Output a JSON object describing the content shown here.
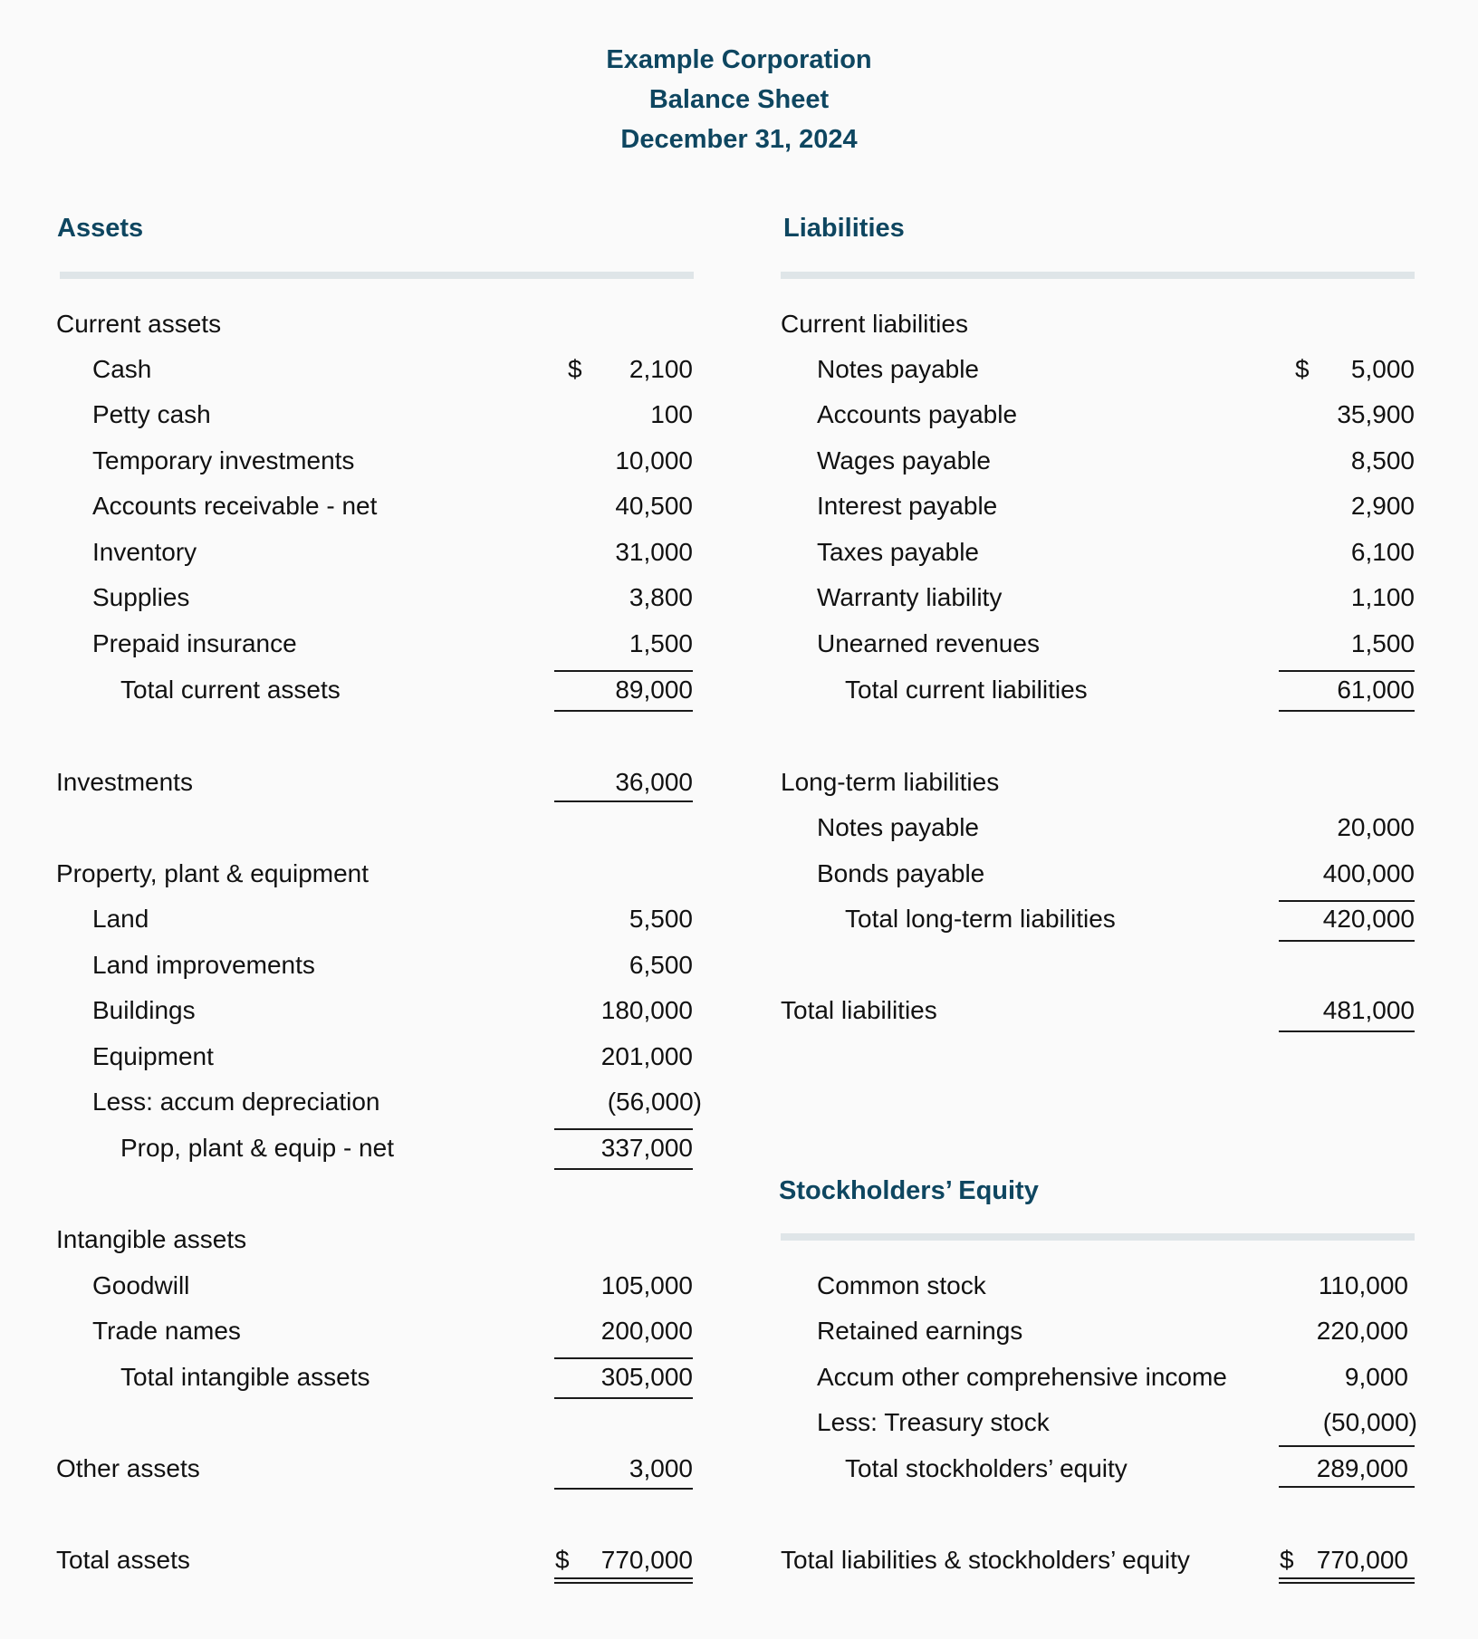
{
  "header": {
    "company": "Example Corporation",
    "statement": "Balance Sheet",
    "date": "December 31, 2024"
  },
  "assets": {
    "heading": "Assets",
    "current": {
      "label": "Current assets",
      "items": [
        {
          "label": "Cash",
          "currency": "$",
          "value": "2,100"
        },
        {
          "label": "Petty cash",
          "value": "100"
        },
        {
          "label": "Temporary investments",
          "value": "10,000"
        },
        {
          "label": "Accounts receivable - net",
          "value": "40,500"
        },
        {
          "label": "Inventory",
          "value": "31,000"
        },
        {
          "label": "Supplies",
          "value": "3,800"
        },
        {
          "label": "Prepaid insurance",
          "value": "1,500"
        }
      ],
      "total_label": "Total current assets",
      "total_value": "89,000"
    },
    "investments": {
      "label": "Investments",
      "value": "36,000"
    },
    "ppe": {
      "label": "Property, plant & equipment",
      "items": [
        {
          "label": "Land",
          "value": "5,500"
        },
        {
          "label": "Land improvements",
          "value": "6,500"
        },
        {
          "label": "Buildings",
          "value": "180,000"
        },
        {
          "label": "Equipment",
          "value": "201,000"
        },
        {
          "label": "Less: accum depreciation",
          "value": "(56,000)"
        }
      ],
      "total_label": "Prop, plant & equip - net",
      "total_value": "337,000"
    },
    "intangible": {
      "label": "Intangible assets",
      "items": [
        {
          "label": "Goodwill",
          "value": "105,000"
        },
        {
          "label": "Trade names",
          "value": "200,000"
        }
      ],
      "total_label": "Total intangible assets",
      "total_value": "305,000"
    },
    "other": {
      "label": "Other assets",
      "value": "3,000"
    },
    "total": {
      "label": "Total assets",
      "currency": "$",
      "value": "770,000"
    }
  },
  "liabilities": {
    "heading": "Liabilities",
    "current": {
      "label": "Current liabilities",
      "items": [
        {
          "label": "Notes payable",
          "currency": "$",
          "value": "5,000"
        },
        {
          "label": "Accounts payable",
          "value": "35,900"
        },
        {
          "label": "Wages payable",
          "value": "8,500"
        },
        {
          "label": "Interest payable",
          "value": "2,900"
        },
        {
          "label": "Taxes payable",
          "value": "6,100"
        },
        {
          "label": "Warranty liability",
          "value": "1,100"
        },
        {
          "label": "Unearned revenues",
          "value": "1,500"
        }
      ],
      "total_label": "Total current liabilities",
      "total_value": "61,000"
    },
    "long_term": {
      "label": "Long-term liabilities",
      "items": [
        {
          "label": "Notes payable",
          "value": "20,000"
        },
        {
          "label": "Bonds payable",
          "value": "400,000"
        }
      ],
      "total_label": "Total long-term liabilities",
      "total_value": "420,000"
    },
    "total": {
      "label": "Total liabilities",
      "value": "481,000"
    }
  },
  "equity": {
    "heading": "Stockholders’ Equity",
    "items": [
      {
        "label": "Common stock",
        "value": "110,000"
      },
      {
        "label": "Retained earnings",
        "value": "220,000"
      },
      {
        "label": "Accum other comprehensive income",
        "value": "9,000"
      },
      {
        "label": "Less: Treasury stock",
        "value": "(50,000)"
      }
    ],
    "total_label": "Total stockholders’ equity",
    "total_value": "289,000"
  },
  "grand_total": {
    "label": "Total liabilities & stockholders’ equity",
    "currency": "$",
    "value": "770,000"
  }
}
